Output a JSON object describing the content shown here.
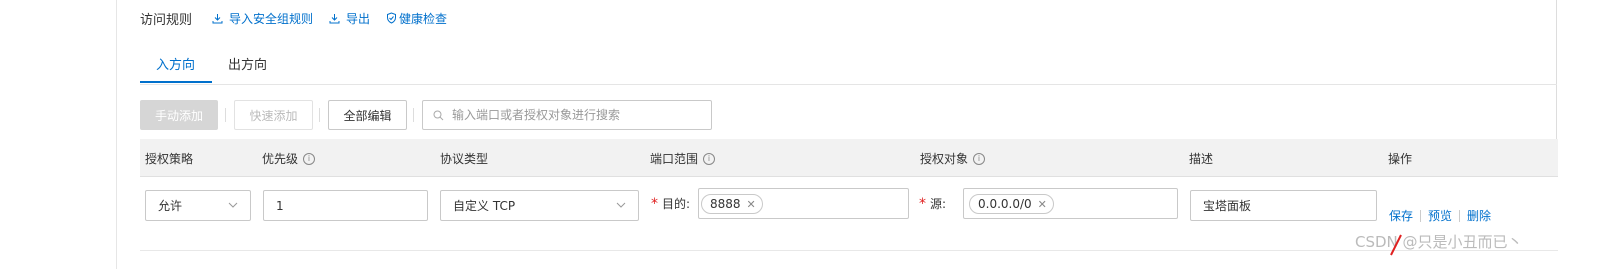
{
  "header": {
    "title": "访问规则",
    "import_label": "导入安全组规则",
    "export_label": "导出",
    "health_label": "健康检查"
  },
  "tabs": [
    {
      "label": "入方向",
      "active": true
    },
    {
      "label": "出方向",
      "active": false
    }
  ],
  "toolbar": {
    "manual_add": "手动添加",
    "quick_add": "快速添加",
    "edit_all": "全部编辑",
    "search_placeholder": "输入端口或者授权对象进行搜索"
  },
  "table": {
    "columns": [
      "授权策略",
      "优先级",
      "协议类型",
      "端口范围",
      "授权对象",
      "描述",
      "操作"
    ],
    "row": {
      "policy": "允许",
      "priority": "1",
      "protocol": "自定义 TCP",
      "dest_label": "目的:",
      "port_tag": "8888",
      "source_label": "源:",
      "source_tag": "0.0.0.0/0",
      "description": "宝塔面板"
    },
    "actions": [
      "保存",
      "预览",
      "删除"
    ]
  },
  "watermark": "CSDN @只是小丑而已丶",
  "colors": {
    "link": "#0070cc",
    "required": "#e02020",
    "header_bg": "#f2f2f2"
  }
}
